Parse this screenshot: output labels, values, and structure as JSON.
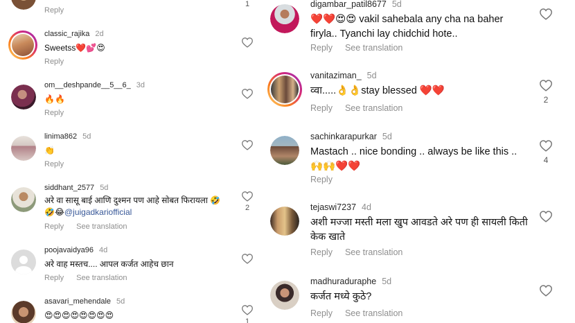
{
  "colors": {
    "secondary_text": "#8e8e8e",
    "mention": "#385898",
    "story_ring": "#d62976"
  },
  "left_column": {
    "top_partial": {
      "actions": {
        "reply": "Reply"
      },
      "like_count": "1"
    },
    "comments": [
      {
        "username": "classic_rajika",
        "age": "2d",
        "text": "Sweetss❤️💕😍",
        "actions": {
          "reply": "Reply"
        }
      },
      {
        "username": "om__deshpande__5__6_",
        "age": "3d",
        "text": "🔥🔥",
        "actions": {
          "reply": "Reply"
        }
      },
      {
        "username": "linima862",
        "age": "5d",
        "text": "👏",
        "actions": {
          "reply": "Reply"
        }
      },
      {
        "username": "siddhant_2577",
        "age": "5d",
        "text_line1": "अरे वा सासू बाई आणि दुश्मन पण आहे सोबत फिरायला 🤣",
        "text_line2_prefix": "🤣😂",
        "mention": "@juigadkariofficial",
        "actions": {
          "reply": "Reply",
          "translate": "See translation"
        },
        "like_count": "2"
      },
      {
        "username": "poojavaidya96",
        "age": "4d",
        "text": "अरे वाह मस्तच.... आपल कर्जत आहेच छान",
        "actions": {
          "reply": "Reply",
          "translate": "See translation"
        }
      },
      {
        "username": "asavari_mehendale",
        "age": "5d",
        "text": "😍😍😍😍😍😍😍😍",
        "like_count": "1"
      }
    ]
  },
  "right_column": {
    "comments": [
      {
        "username": "digambar_patil8677",
        "age": "5d",
        "text_line1": "❤️❤️😍😍 vakil sahebala any cha na baher",
        "text_line2": "firyla.. Tyanchi lay chidchid hote..",
        "actions": {
          "reply": "Reply",
          "translate": "See translation"
        }
      },
      {
        "username": "vanitaziman_",
        "age": "5d",
        "text": "व्वा.....👌👌stay blessed ❤️❤️",
        "actions": {
          "reply": "Reply",
          "translate": "See translation"
        },
        "like_count": "2"
      },
      {
        "username": "sachinkarapurkar",
        "age": "5d",
        "text_line1": "Mastach .. nice bonding .. always be like this ..",
        "text_line2": "🙌🙌❤️❤️",
        "actions": {
          "reply": "Reply"
        },
        "like_count": "4"
      },
      {
        "username": "tejaswi7237",
        "age": "4d",
        "text_line1": "अशी मज्जा मस्ती मला खुप आवडते अरे पण ही सायली किती",
        "text_line2": "केक खाते",
        "actions": {
          "reply": "Reply",
          "translate": "See translation"
        }
      },
      {
        "username": "madhuraduraphe",
        "age": "5d",
        "text": "कर्जत मध्ये कुठे?",
        "actions": {
          "reply": "Reply",
          "translate": "See translation"
        }
      }
    ]
  }
}
